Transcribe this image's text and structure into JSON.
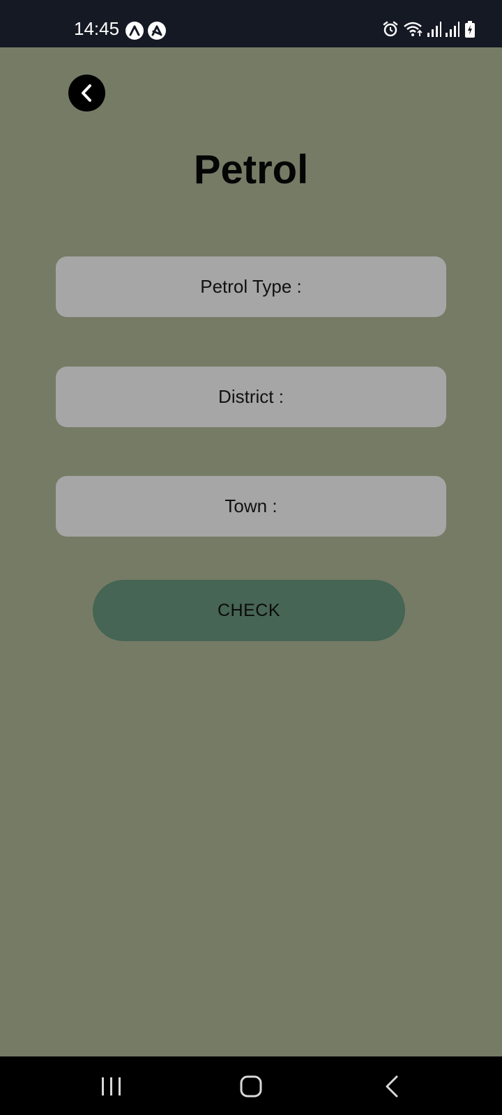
{
  "status_bar": {
    "time": "14:45",
    "left_icons": [
      "notification-app-icon",
      "notification-app-icon-2"
    ],
    "right_icons": [
      "alarm-icon",
      "wifi-icon",
      "signal-icon",
      "signal-icon-2",
      "battery-charging-icon"
    ]
  },
  "header": {
    "back_icon": "chevron-left-icon",
    "title": "Petrol"
  },
  "form": {
    "petrol_type_label": "Petrol Type :",
    "district_label": "District :",
    "town_label": "Town :",
    "check_label": "CHECK"
  },
  "nav_bar": {
    "icons": [
      "recent-apps-icon",
      "home-icon",
      "back-icon"
    ]
  },
  "colors": {
    "background": "#767b66",
    "status_bar": "#151923",
    "field": "#a6a6a6",
    "button": "#466554",
    "nav_bar": "#000000"
  }
}
